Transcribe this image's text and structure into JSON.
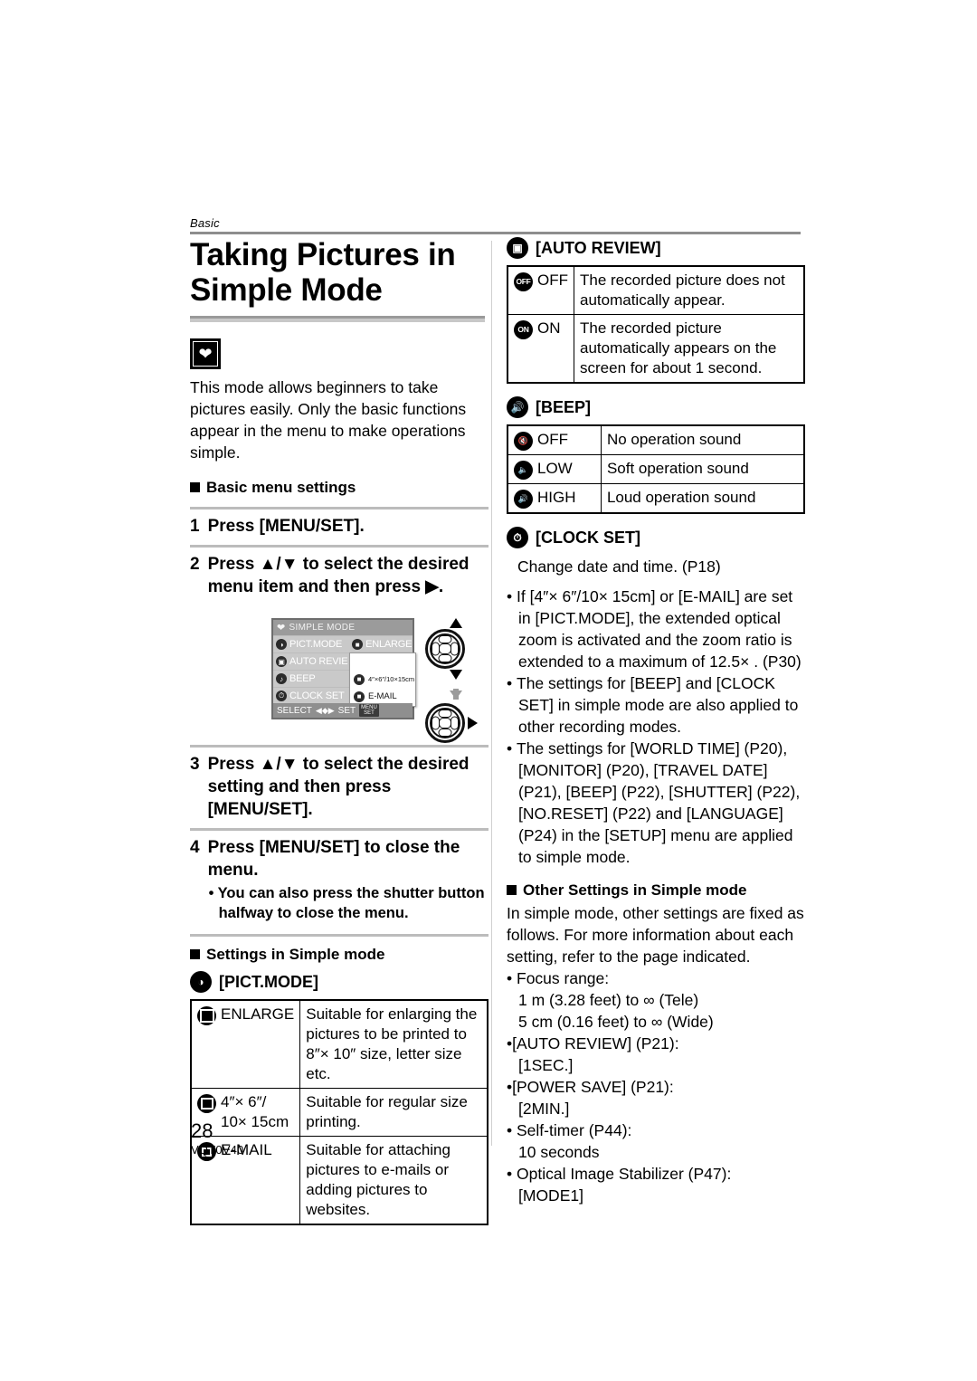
{
  "header": {
    "chapter": "Basic"
  },
  "left": {
    "title": "Taking Pictures in Simple Mode",
    "mode_icon": "heart-mode-icon",
    "intro": "This mode allows beginners to take pictures easily. Only the basic functions appear in the menu to make operations simple.",
    "basic_menu_heading": "Basic menu settings",
    "steps": [
      {
        "num": "1",
        "text": "Press [MENU/SET]."
      },
      {
        "num": "2",
        "text": "Press ▲/▼ to select the desired menu item and then press ▶."
      },
      {
        "num": "3",
        "text": "Press ▲/▼ to select the desired setting and then press [MENU/SET]."
      },
      {
        "num": "4",
        "text": "Press [MENU/SET] to close the menu.",
        "sub": "• You can also press the shutter button halfway to close the menu."
      }
    ],
    "lcd": {
      "title": "SIMPLE MODE",
      "rows": [
        {
          "icon": "pict-mode-icon",
          "label": "PICT.MODE",
          "value": "ENLARGE"
        },
        {
          "icon": "auto-review-icon",
          "label": "AUTO REVIE"
        },
        {
          "icon": "beep-icon",
          "label": "BEEP"
        },
        {
          "icon": "clock-set-icon",
          "label": "CLOCK SET"
        }
      ],
      "popup": [
        {
          "icon": "enlarge-icon",
          "label": "ENLARGE"
        },
        {
          "icon": "4x6-icon",
          "label": "4″×6″/10×15cm"
        },
        {
          "icon": "email-icon",
          "label": "E-MAIL"
        }
      ],
      "footer_select": "SELECT",
      "footer_set": "SET",
      "footer_badge_top": "MENU",
      "footer_badge_bottom": "SET"
    },
    "settings_heading": "Settings in Simple mode",
    "pict_mode_heading": "[PICT.MODE]",
    "pict_mode_table": [
      {
        "icon": "enlarge-icon",
        "key": "ENLARGE",
        "desc": "Suitable for enlarging the pictures to be printed to 8″× 10″ size, letter size etc."
      },
      {
        "icon": "4x6-icon",
        "key": "4″× 6″/\n10× 15cm",
        "desc": "Suitable for regular size printing."
      },
      {
        "icon": "email-icon",
        "key": "E-MAIL",
        "desc": "Suitable for attaching pictures to e-mails or adding pictures to websites."
      }
    ]
  },
  "right": {
    "auto_review_heading": "[AUTO REVIEW]",
    "auto_review_icon": "auto-review-icon",
    "auto_review_table": [
      {
        "icon": "off-badge-icon",
        "key": "OFF",
        "desc": "The recorded picture does not automatically appear."
      },
      {
        "icon": "on-badge-icon",
        "key": "ON",
        "desc": "The recorded picture automatically appears on the screen for about 1 second."
      }
    ],
    "beep_heading": "[BEEP]",
    "beep_icon": "beep-icon",
    "beep_table": [
      {
        "icon": "speaker-mute-icon",
        "key": "OFF",
        "desc": "No operation sound"
      },
      {
        "icon": "speaker-low-icon",
        "key": "LOW",
        "desc": "Soft operation sound"
      },
      {
        "icon": "speaker-high-icon",
        "key": "HIGH",
        "desc": "Loud operation sound"
      }
    ],
    "clock_set_heading": "[CLOCK SET]",
    "clock_set_icon": "clock-set-icon",
    "clock_set_note": "Change date and time. (P18)",
    "bullets": [
      "If [4″× 6″/10× 15cm] or [E-MAIL] are set in [PICT.MODE], the extended optical zoom is activated and the zoom ratio is extended to a maximum of 12.5× . (P30)",
      "The settings for [BEEP] and [CLOCK SET] in simple mode are also applied to other recording modes.",
      "The settings for [WORLD TIME] (P20), [MONITOR] (P20), [TRAVEL DATE] (P21), [BEEP] (P22), [SHUTTER] (P22), [NO.RESET] (P22) and [LANGUAGE] (P24) in the [SETUP] menu are applied to simple mode."
    ],
    "other_settings_heading": "Other Settings in Simple mode",
    "other_settings_intro": "In simple mode, other settings are fixed as follows. For more information about each setting, refer to the page indicated.",
    "other_settings": [
      {
        "label": "Focus range:",
        "values": [
          "1 m (3.28 feet) to ∞ (Tele)",
          "5 cm (0.16 feet) to ∞ (Wide)"
        ]
      },
      {
        "label": "[AUTO REVIEW] (P21):",
        "values": [
          "[1SEC.]"
        ]
      },
      {
        "label": "[POWER SAVE] (P21):",
        "values": [
          "[2MIN.]"
        ]
      },
      {
        "label": "Self-timer (P44):",
        "values": [
          "10 seconds"
        ]
      },
      {
        "label": "Optical Image Stabilizer (P47):",
        "values": [
          "[MODE1]"
        ]
      }
    ]
  },
  "footer": {
    "page_number": "28",
    "doc_code": "VQT0V40"
  }
}
